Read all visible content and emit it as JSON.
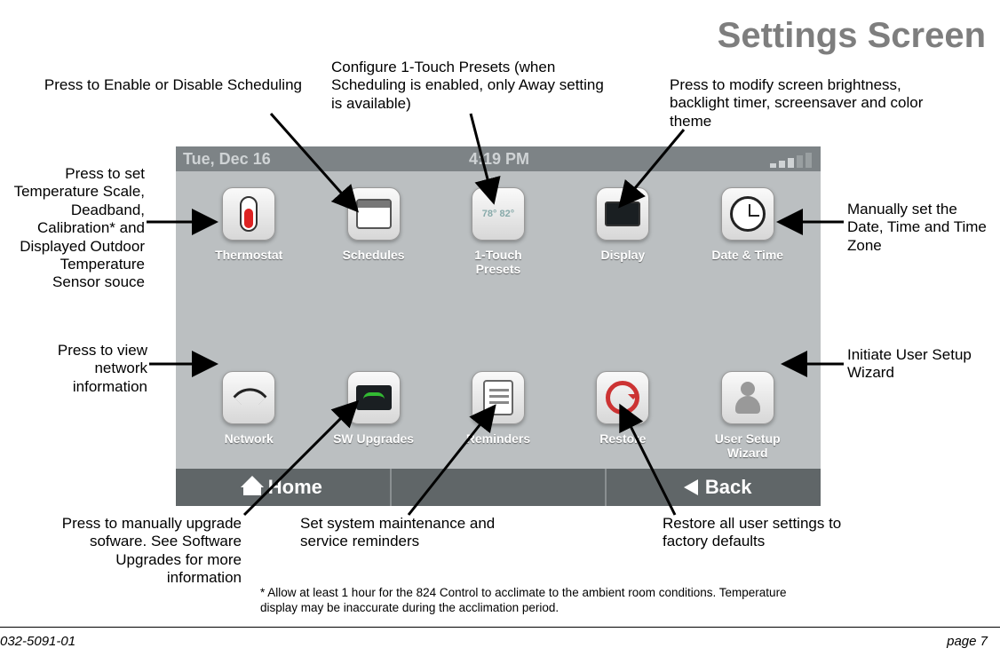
{
  "title": "Settings Screen",
  "statusbar": {
    "date": "Tue, Dec 16",
    "time": "4:19 PM"
  },
  "tiles": {
    "row1": [
      {
        "id": "thermostat",
        "label": "Thermostat"
      },
      {
        "id": "schedules",
        "label": "Schedules"
      },
      {
        "id": "presets",
        "label": "1-Touch\nPresets",
        "preset_text": "78°   82°"
      },
      {
        "id": "display",
        "label": "Display"
      },
      {
        "id": "datetime",
        "label": "Date & Time"
      }
    ],
    "row2": [
      {
        "id": "network",
        "label": "Network"
      },
      {
        "id": "swupgrades",
        "label": "SW Upgrades"
      },
      {
        "id": "reminders",
        "label": "Reminders"
      },
      {
        "id": "restore",
        "label": "Restore"
      },
      {
        "id": "wizard",
        "label": "User Setup\nWizard"
      }
    ]
  },
  "nav": {
    "home": "Home",
    "back": "Back"
  },
  "callouts": {
    "schedules": "Press to Enable or Disable Scheduling",
    "presets": "Configure 1-Touch Presets (when Scheduling is enabled, only Away setting is available)",
    "display": "Press to modify screen brightness, backlight timer, screensaver and color theme",
    "thermostat": "Press to set Temperature Scale, Deadband, Calibration* and Displayed Outdoor Temperature Sensor souce",
    "datetime": "Manually set the Date, Time and Time Zone",
    "network": "Press to view network information",
    "wizard": "Initiate User Setup Wizard",
    "swupgrades": "Press to manually upgrade sofware. See Software Upgrades for more information",
    "reminders": "Set system maintenance and service reminders",
    "restore": "Restore all user settings to factory defaults"
  },
  "footnote": "* Allow at least 1 hour for the 824 Control to acclimate to the ambient room conditions. Temperature display may be inaccurate during the acclimation period.",
  "docnum": "032-5091-01",
  "pagenum": "page 7"
}
